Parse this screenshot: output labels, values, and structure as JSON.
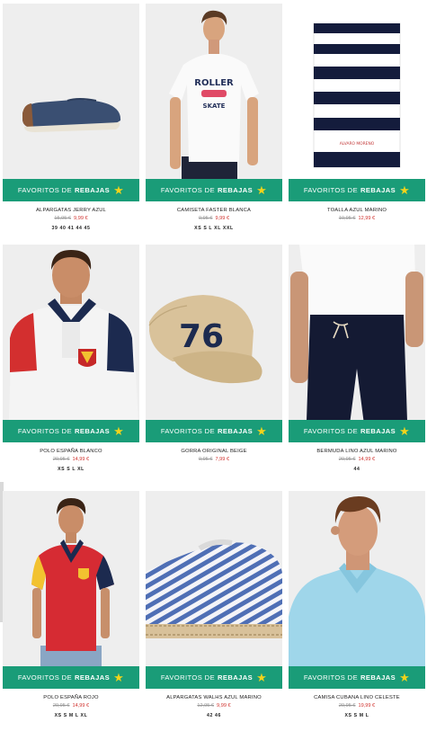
{
  "banner": {
    "label": "FAVORITOS DE",
    "highlight": "REBAJAS",
    "star_color": "#f2d31b",
    "bg_color": "#1a9c78"
  },
  "products": [
    {
      "name": "ALPARGATAS JERRY AZUL",
      "old_price": "15,95 €",
      "new_price": "9,99 €",
      "sizes": "39 40 41 44 45",
      "image": "navy-espadrille"
    },
    {
      "name": "CAMISETA FASTER BLANCA",
      "old_price": "9,95 €",
      "new_price": "9,99 €",
      "sizes": "XS S L XL XXL",
      "image": "white-tshirt-roller-skate",
      "print_top": "ROLLER",
      "print_bottom": "SKATE"
    },
    {
      "name": "TOALLA AZUL MARINO",
      "old_price": "19,95 €",
      "new_price": "12,99 €",
      "sizes": "",
      "image": "striped-towel",
      "towel_logo": "ALVARO MORENO"
    },
    {
      "name": "POLO ESPAÑA BLANCO",
      "old_price": "29,95 €",
      "new_price": "14,99 €",
      "sizes": "XS S L XL",
      "image": "white-polo-spain"
    },
    {
      "name": "GORRA ORIGINAL BEIGE",
      "old_price": "9,95 €",
      "new_price": "7,99 €",
      "sizes": "",
      "image": "beige-cap",
      "cap_number": "76"
    },
    {
      "name": "BERMUDA LINO AZUL MARINO",
      "old_price": "29,95 €",
      "new_price": "14,99 €",
      "sizes": "44",
      "image": "navy-linen-shorts"
    },
    {
      "name": "POLO ESPAÑA ROJO",
      "old_price": "29,95 €",
      "new_price": "14,99 €",
      "sizes": "XS S M L XL",
      "image": "red-polo-spain"
    },
    {
      "name": "ALPARGATAS WALHS AZUL MARINO",
      "old_price": "12,95 €",
      "new_price": "9,99 €",
      "sizes": "42 46",
      "image": "striped-espadrille"
    },
    {
      "name": "CAMISA CUBANA LINO CELESTE",
      "old_price": "29,95 €",
      "new_price": "19,99 €",
      "sizes": "XS S M L",
      "image": "light-blue-linen-shirt"
    }
  ]
}
